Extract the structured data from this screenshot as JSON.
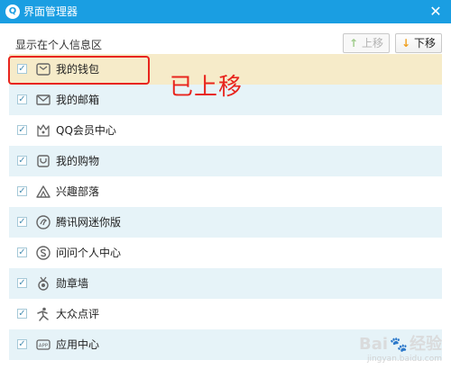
{
  "window": {
    "title": "界面管理器",
    "logo_glyph": "Q",
    "close_glyph": "✕"
  },
  "section_title": "显示在个人信息区",
  "buttons": {
    "up": {
      "label": "上移",
      "arrow": "↑",
      "enabled": false
    },
    "down": {
      "label": "下移",
      "arrow": "↓",
      "enabled": true
    }
  },
  "items": [
    {
      "label": "我的钱包",
      "icon": "wallet-icon",
      "checked": true,
      "selected": true
    },
    {
      "label": "我的邮箱",
      "icon": "mail-icon",
      "checked": true,
      "selected": false
    },
    {
      "label": "QQ会员中心",
      "icon": "vip-crown-icon",
      "checked": true,
      "selected": false
    },
    {
      "label": "我的购物",
      "icon": "shopping-bag-icon",
      "checked": true,
      "selected": false
    },
    {
      "label": "兴趣部落",
      "icon": "tribe-icon",
      "checked": true,
      "selected": false
    },
    {
      "label": "腾讯网迷你版",
      "icon": "tencent-news-icon",
      "checked": true,
      "selected": false
    },
    {
      "label": "问问个人中心",
      "icon": "wenwen-icon",
      "checked": true,
      "selected": false
    },
    {
      "label": "勋章墙",
      "icon": "medal-icon",
      "checked": true,
      "selected": false
    },
    {
      "label": "大众点评",
      "icon": "dianping-icon",
      "checked": true,
      "selected": false
    },
    {
      "label": "应用中心",
      "icon": "app-center-icon",
      "checked": true,
      "selected": false
    }
  ],
  "annotation": "已上移",
  "watermark": {
    "text_left": "Bai",
    "paw": "🐾",
    "text_right": "经验",
    "sub": "jingyan.baidu.com"
  },
  "colors": {
    "titlebar": "#1a9ee2",
    "selected_row": "#f6ebc9",
    "alt_row": "#e6f3f8",
    "annotation": "#e8251e"
  }
}
